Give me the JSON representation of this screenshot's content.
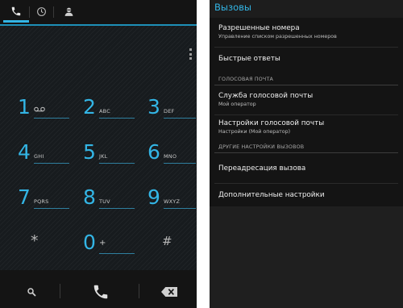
{
  "dialer": {
    "tabs": [
      {
        "icon": "phone-icon",
        "active": true
      },
      {
        "icon": "clock-icon",
        "active": false
      },
      {
        "icon": "contacts-icon",
        "active": false
      }
    ],
    "accent_color": "#33b5e5",
    "keys": [
      {
        "digit": "1",
        "letters": "ᴼᴼ"
      },
      {
        "digit": "2",
        "letters": "ABC"
      },
      {
        "digit": "3",
        "letters": "DEF"
      },
      {
        "digit": "4",
        "letters": "GHI"
      },
      {
        "digit": "5",
        "letters": "JKL"
      },
      {
        "digit": "6",
        "letters": "MNO"
      },
      {
        "digit": "7",
        "letters": "PQRS"
      },
      {
        "digit": "8",
        "letters": "TUV"
      },
      {
        "digit": "9",
        "letters": "WXYZ"
      },
      {
        "digit": "*",
        "letters": ""
      },
      {
        "digit": "0",
        "letters": "+"
      },
      {
        "digit": "#",
        "letters": ""
      }
    ],
    "bottom_icons": [
      "search-icon",
      "call-icon",
      "backspace-icon"
    ]
  },
  "settings": {
    "header": "Вызовы",
    "items": {
      "fdn_title": "Разрешенные номера",
      "fdn_sub": "Управление списком разрешенных номеров",
      "quick_title": "Быстрые ответы",
      "vm_section": "ГОЛОСОВАЯ ПОЧТА",
      "vm_service_title": "Служба голосовой почты",
      "vm_service_sub": "Мой оператор",
      "vm_settings_title": "Настройки голосовой почты",
      "vm_settings_sub": "Настройки (Мой оператор)",
      "other_section": "ДРУГИЕ НАСТРОЙКИ ВЫЗОВОВ",
      "forward_title": "Переадресация вызова",
      "additional_title": "Дополнительные настройки"
    }
  }
}
